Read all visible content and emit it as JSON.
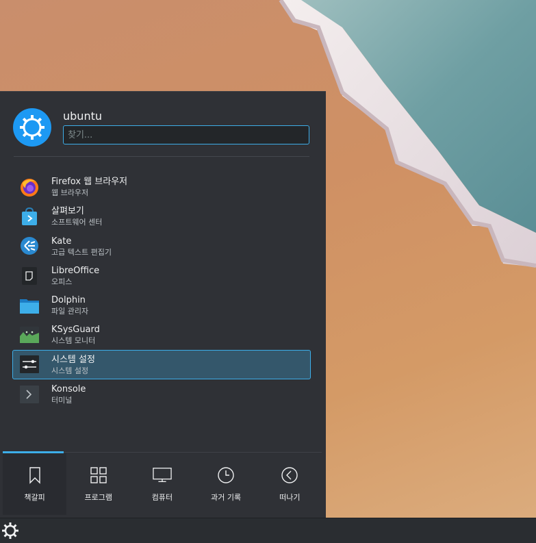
{
  "user": {
    "name": "ubuntu"
  },
  "search": {
    "placeholder": "찾기..."
  },
  "apps": [
    {
      "name": "Firefox 웹 브라우저",
      "desc": "웹 브라우저",
      "icon": "firefox-icon"
    },
    {
      "name": "살펴보기",
      "desc": "소프트웨어 센터",
      "icon": "discover-icon"
    },
    {
      "name": "Kate",
      "desc": "고급 텍스트 편집기",
      "icon": "kate-icon"
    },
    {
      "name": "LibreOffice",
      "desc": "오피스",
      "icon": "libreoffice-icon"
    },
    {
      "name": "Dolphin",
      "desc": "파일 관리자",
      "icon": "folder-icon"
    },
    {
      "name": "KSysGuard",
      "desc": "시스템 모니터",
      "icon": "ksysguard-icon"
    },
    {
      "name": "시스템 설정",
      "desc": "시스템 설정",
      "icon": "settings-icon"
    },
    {
      "name": "Konsole",
      "desc": "터미널",
      "icon": "terminal-icon"
    }
  ],
  "tabs": [
    {
      "label": "책갈피",
      "icon": "bookmark-icon"
    },
    {
      "label": "프로그램",
      "icon": "grid-icon"
    },
    {
      "label": "컴퓨터",
      "icon": "monitor-icon"
    },
    {
      "label": "과거 기록",
      "icon": "clock-icon"
    },
    {
      "label": "떠나기",
      "icon": "back-circle-icon"
    }
  ],
  "colors": {
    "accent": "#3daee9",
    "panel": "#2f3136",
    "highlight": "#34576b",
    "kde_blue": "#1d99f3"
  }
}
